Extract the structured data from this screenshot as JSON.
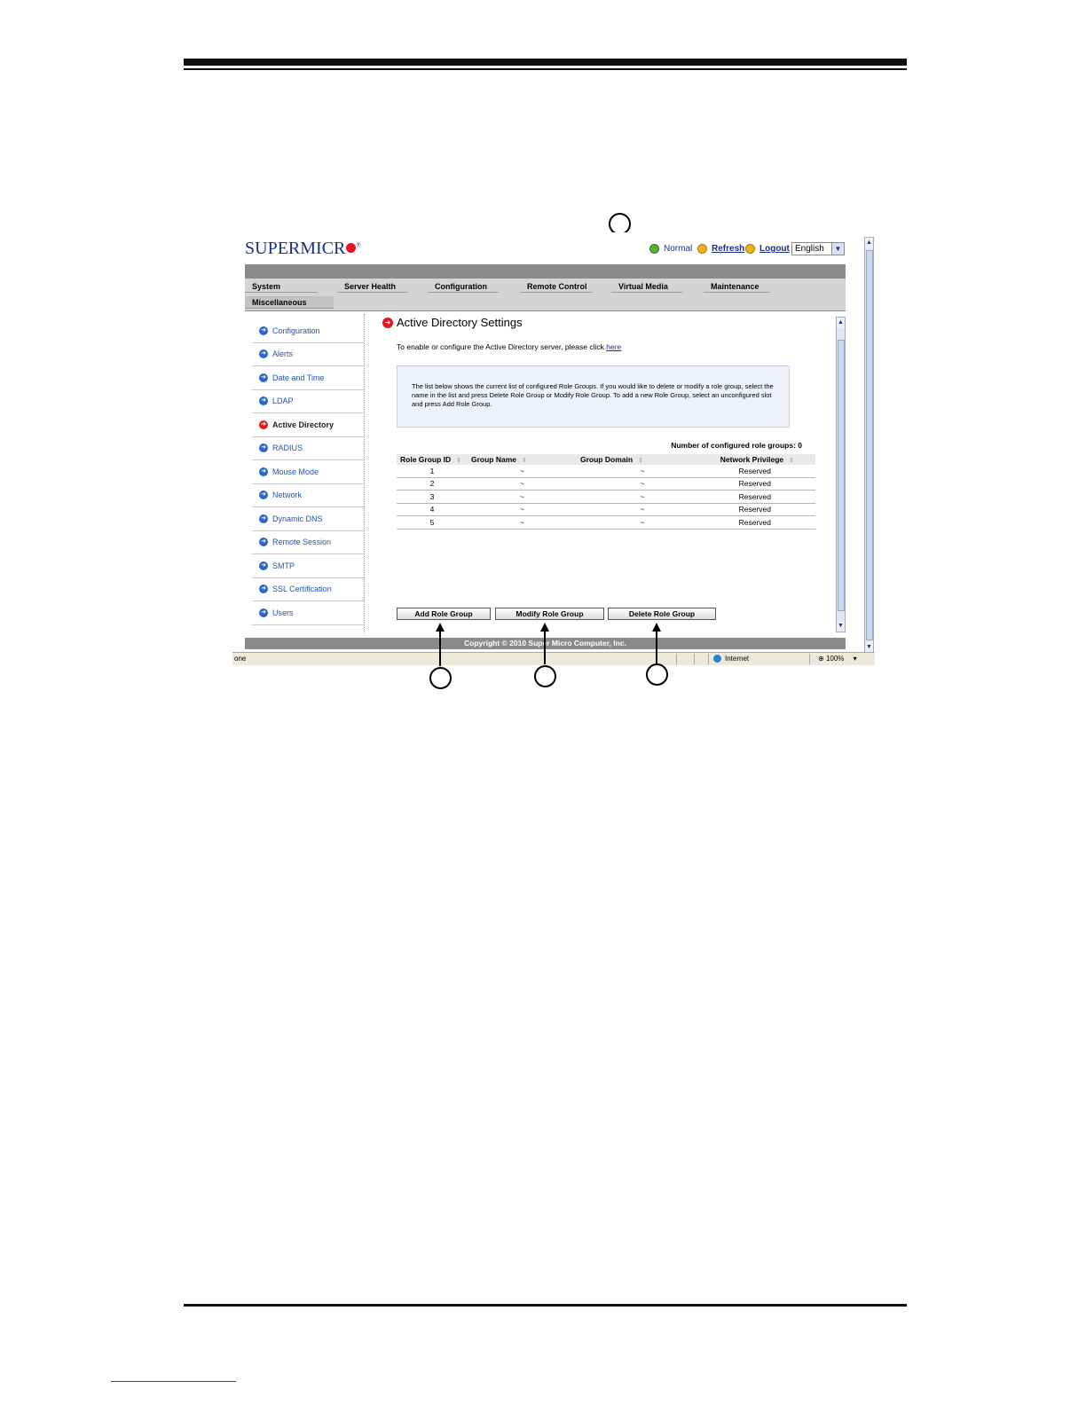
{
  "app": {
    "logo": "SUPERMICR",
    "status": "Normal",
    "refresh_label": "Refresh",
    "logout_label": "Logout",
    "language": "English"
  },
  "nav": {
    "tabs": [
      "System",
      "Server Health",
      "Configuration",
      "Remote Control",
      "Virtual Media",
      "Maintenance",
      "Miscellaneous"
    ]
  },
  "sidebar": {
    "items": [
      {
        "label": "Configuration",
        "active": false
      },
      {
        "label": "Alerts",
        "active": false
      },
      {
        "label": "Date and Time",
        "active": false
      },
      {
        "label": "LDAP",
        "active": false
      },
      {
        "label": "Active Directory",
        "active": true
      },
      {
        "label": "RADIUS",
        "active": false
      },
      {
        "label": "Mouse Mode",
        "active": false
      },
      {
        "label": "Network",
        "active": false
      },
      {
        "label": "Dynamic DNS",
        "active": false
      },
      {
        "label": "Remote Session",
        "active": false
      },
      {
        "label": "SMTP",
        "active": false
      },
      {
        "label": "SSL Certification",
        "active": false
      },
      {
        "label": "Users",
        "active": false
      }
    ]
  },
  "main": {
    "title": "Active Directory Settings",
    "intro_text": "To enable or configure the Active Directory server, please click",
    "intro_link": "here",
    "info_text": "The list below shows the current list of configured Role Groups. If you would like to delete or modify a role group, select the name in the list and press Delete Role Group or Modify Role Group. To add a new Role Group, select an unconfigured slot and press Add Role Group.",
    "count_label": "Number of configured role groups: 0",
    "table": {
      "headers": [
        "Role Group ID",
        "Group Name",
        "Group Domain",
        "Network Privilege"
      ],
      "rows": [
        [
          "1",
          "~",
          "~",
          "Reserved"
        ],
        [
          "2",
          "~",
          "~",
          "Reserved"
        ],
        [
          "3",
          "~",
          "~",
          "Reserved"
        ],
        [
          "4",
          "~",
          "~",
          "Reserved"
        ],
        [
          "5",
          "~",
          "~",
          "Reserved"
        ]
      ]
    },
    "buttons": {
      "add": "Add Role Group",
      "modify": "Modify Role Group",
      "delete": "Delete Role Group"
    }
  },
  "footer": {
    "copyright": "Copyright © 2010 Super Micro Computer, Inc."
  },
  "statusbar": {
    "left": "one",
    "zone": "Internet",
    "zoom": "100%"
  },
  "colors": {
    "brand_blue": "#1b2f86",
    "active_red": "#e3161e",
    "link_blue": "#2553a5"
  }
}
